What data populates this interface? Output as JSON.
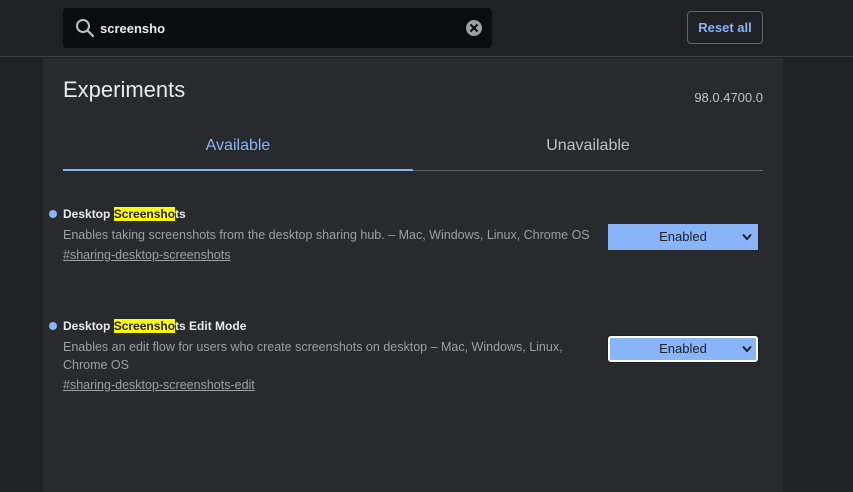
{
  "search": {
    "value": "screensho",
    "placeholder": "Search flags"
  },
  "header": {
    "reset_label": "Reset all"
  },
  "page": {
    "title": "Experiments",
    "version": "98.0.4700.0"
  },
  "tabs": [
    {
      "label": "Available",
      "active": true
    },
    {
      "label": "Unavailable",
      "active": false
    }
  ],
  "experiments": [
    {
      "title_pre": "Desktop ",
      "title_highlight": "Screensho",
      "title_post": "ts",
      "description": "Enables taking screenshots from the desktop sharing hub. – Mac, Windows, Linux, Chrome OS",
      "link": "#sharing-desktop-screenshots",
      "selected": "Enabled"
    },
    {
      "title_pre": "Desktop ",
      "title_highlight": "Screensho",
      "title_post": "ts Edit Mode",
      "description": "Enables an edit flow for users who create screenshots on desktop – Mac, Windows, Linux, Chrome OS",
      "link": "#sharing-desktop-screenshots-edit",
      "selected": "Enabled"
    }
  ],
  "colors": {
    "background": "#202124",
    "panel": "#292a2d",
    "accent": "#8ab4f8",
    "highlight": "#ffff00"
  },
  "icons": {
    "search": "search-icon",
    "clear": "clear-icon",
    "dropdown": "chevron-down-icon"
  }
}
